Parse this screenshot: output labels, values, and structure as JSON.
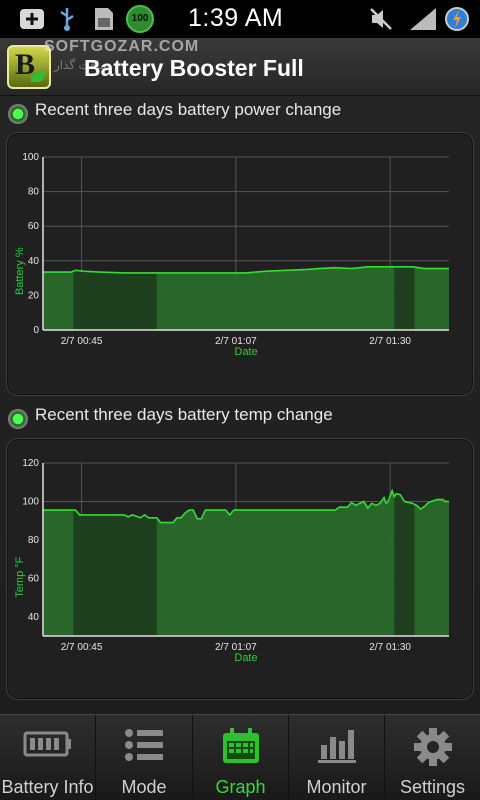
{
  "status_bar": {
    "time": "1:39 AM",
    "battery_badge": "100",
    "icons": [
      "add-icon",
      "usb-icon",
      "sd-card-icon",
      "battery-badge-icon",
      "mute-icon",
      "signal-icon",
      "sync-icon"
    ]
  },
  "watermark": {
    "text": "SOFTGOZAR.COM",
    "subtext": "سافت گذار"
  },
  "header": {
    "title": "Battery Booster Full",
    "icon_letter": "B"
  },
  "sections": [
    {
      "label": "Recent three days battery power change"
    },
    {
      "label": "Recent three days battery temp change"
    }
  ],
  "chart_data": [
    {
      "type": "area",
      "title": "Recent three days battery power change",
      "xlabel": "Date",
      "ylabel": "Battery %",
      "ylim": [
        0,
        100
      ],
      "yticks": [
        "0",
        "20",
        "40",
        "60",
        "80",
        "100"
      ],
      "xticks": [
        "2/7 00:45",
        "2/7 01:07",
        "2/7 01:30"
      ],
      "grid": true,
      "x_range": [
        0,
        100
      ],
      "points": [
        [
          0,
          33.5
        ],
        [
          7,
          33.5
        ],
        [
          8,
          34.5
        ],
        [
          10,
          34
        ],
        [
          14,
          33.5
        ],
        [
          20,
          33
        ],
        [
          40,
          33
        ],
        [
          50,
          33
        ],
        [
          55,
          34
        ],
        [
          65,
          35
        ],
        [
          68,
          35.5
        ],
        [
          72,
          36
        ],
        [
          76,
          35.5
        ],
        [
          80,
          36.5
        ],
        [
          86,
          36.5
        ],
        [
          91,
          36.5
        ],
        [
          94,
          35.5
        ],
        [
          100,
          35.5
        ]
      ],
      "shaded_bands": [
        [
          7.5,
          28
        ],
        [
          86.5,
          91.5
        ]
      ],
      "line_color": "#35dd35",
      "fill_color": "#2a6a2a"
    },
    {
      "type": "area",
      "title": "Recent three days battery temp change",
      "xlabel": "Date",
      "ylabel": "Temp °F",
      "ylim": [
        30,
        120
      ],
      "yticks": [
        "40",
        "60",
        "80",
        "100",
        "120"
      ],
      "xticks": [
        "2/7 00:45",
        "2/7 01:07",
        "2/7 01:30"
      ],
      "grid": true,
      "x_range": [
        0,
        100
      ],
      "points": [
        [
          0,
          95.5
        ],
        [
          8,
          95.5
        ],
        [
          9,
          93
        ],
        [
          18,
          93
        ],
        [
          20,
          93
        ],
        [
          21,
          92
        ],
        [
          22,
          93
        ],
        [
          24,
          91.5
        ],
        [
          25,
          93
        ],
        [
          26,
          91.5
        ],
        [
          28,
          91.5
        ],
        [
          29,
          89
        ],
        [
          30,
          89
        ],
        [
          31,
          89
        ],
        [
          32,
          89
        ],
        [
          33,
          91.5
        ],
        [
          34,
          91.5
        ],
        [
          35,
          94
        ],
        [
          36,
          95.5
        ],
        [
          37,
          95.5
        ],
        [
          38,
          91
        ],
        [
          39,
          91
        ],
        [
          40,
          95.5
        ],
        [
          42,
          95.5
        ],
        [
          45,
          95.5
        ],
        [
          46,
          93
        ],
        [
          47,
          95.5
        ],
        [
          55,
          95.5
        ],
        [
          65,
          95.5
        ],
        [
          70,
          95.5
        ],
        [
          72,
          95.5
        ],
        [
          73,
          97
        ],
        [
          75,
          97
        ],
        [
          76,
          99.5
        ],
        [
          77,
          98
        ],
        [
          78,
          99
        ],
        [
          79,
          100
        ],
        [
          80,
          96.5
        ],
        [
          81,
          99
        ],
        [
          82,
          98
        ],
        [
          83,
          99
        ],
        [
          84,
          102
        ],
        [
          84.5,
          99
        ],
        [
          85,
          100
        ],
        [
          86,
          105.5
        ],
        [
          86.5,
          102.5
        ],
        [
          87,
          104
        ],
        [
          88,
          103.5
        ],
        [
          89,
          100
        ],
        [
          91,
          99
        ],
        [
          92,
          98
        ],
        [
          93,
          96
        ],
        [
          94,
          97.5
        ],
        [
          95,
          99.5
        ],
        [
          97,
          101
        ],
        [
          98.5,
          101
        ],
        [
          99,
          100
        ],
        [
          100,
          100
        ]
      ],
      "shaded_bands": [
        [
          7.5,
          28
        ],
        [
          86.5,
          91.5
        ]
      ],
      "line_color": "#35dd35",
      "fill_color": "#2a6a2a"
    }
  ],
  "tabs": [
    {
      "label": "Battery Info",
      "icon": "battery-icon",
      "active": false
    },
    {
      "label": "Mode",
      "icon": "list-icon",
      "active": false
    },
    {
      "label": "Graph",
      "icon": "calendar-graph-icon",
      "active": true
    },
    {
      "label": "Monitor",
      "icon": "bar-chart-icon",
      "active": false
    },
    {
      "label": "Settings",
      "icon": "gear-icon",
      "active": false
    }
  ],
  "colors": {
    "accent": "#33dd33",
    "background": "#1e1e1e"
  }
}
